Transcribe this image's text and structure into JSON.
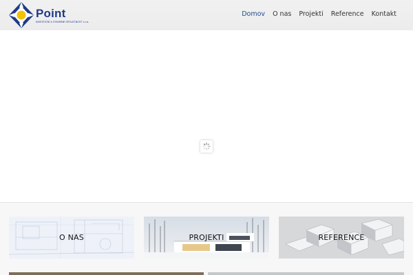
{
  "brand": {
    "name": "Point",
    "tagline": "INVESTIČNÍ A STAVEBNÍ SPOLEČNOST s.r.o.",
    "colors": {
      "primary": "#1f3a8a",
      "accent": "#f2c200"
    }
  },
  "nav": {
    "items": [
      {
        "label": "Domov",
        "active": true
      },
      {
        "label": "O nas",
        "active": false
      },
      {
        "label": "Projekti",
        "active": false
      },
      {
        "label": "Reference",
        "active": false
      },
      {
        "label": "Kontakt",
        "active": false
      }
    ]
  },
  "slider": {
    "loader_icon": "spinner-icon"
  },
  "tiles": [
    {
      "label": "O NAS",
      "image": "blueprint-image"
    },
    {
      "label": "PROJEKTI",
      "image": "modern-house-image"
    },
    {
      "label": "REFERENCE",
      "image": "architecture-model-image"
    }
  ]
}
